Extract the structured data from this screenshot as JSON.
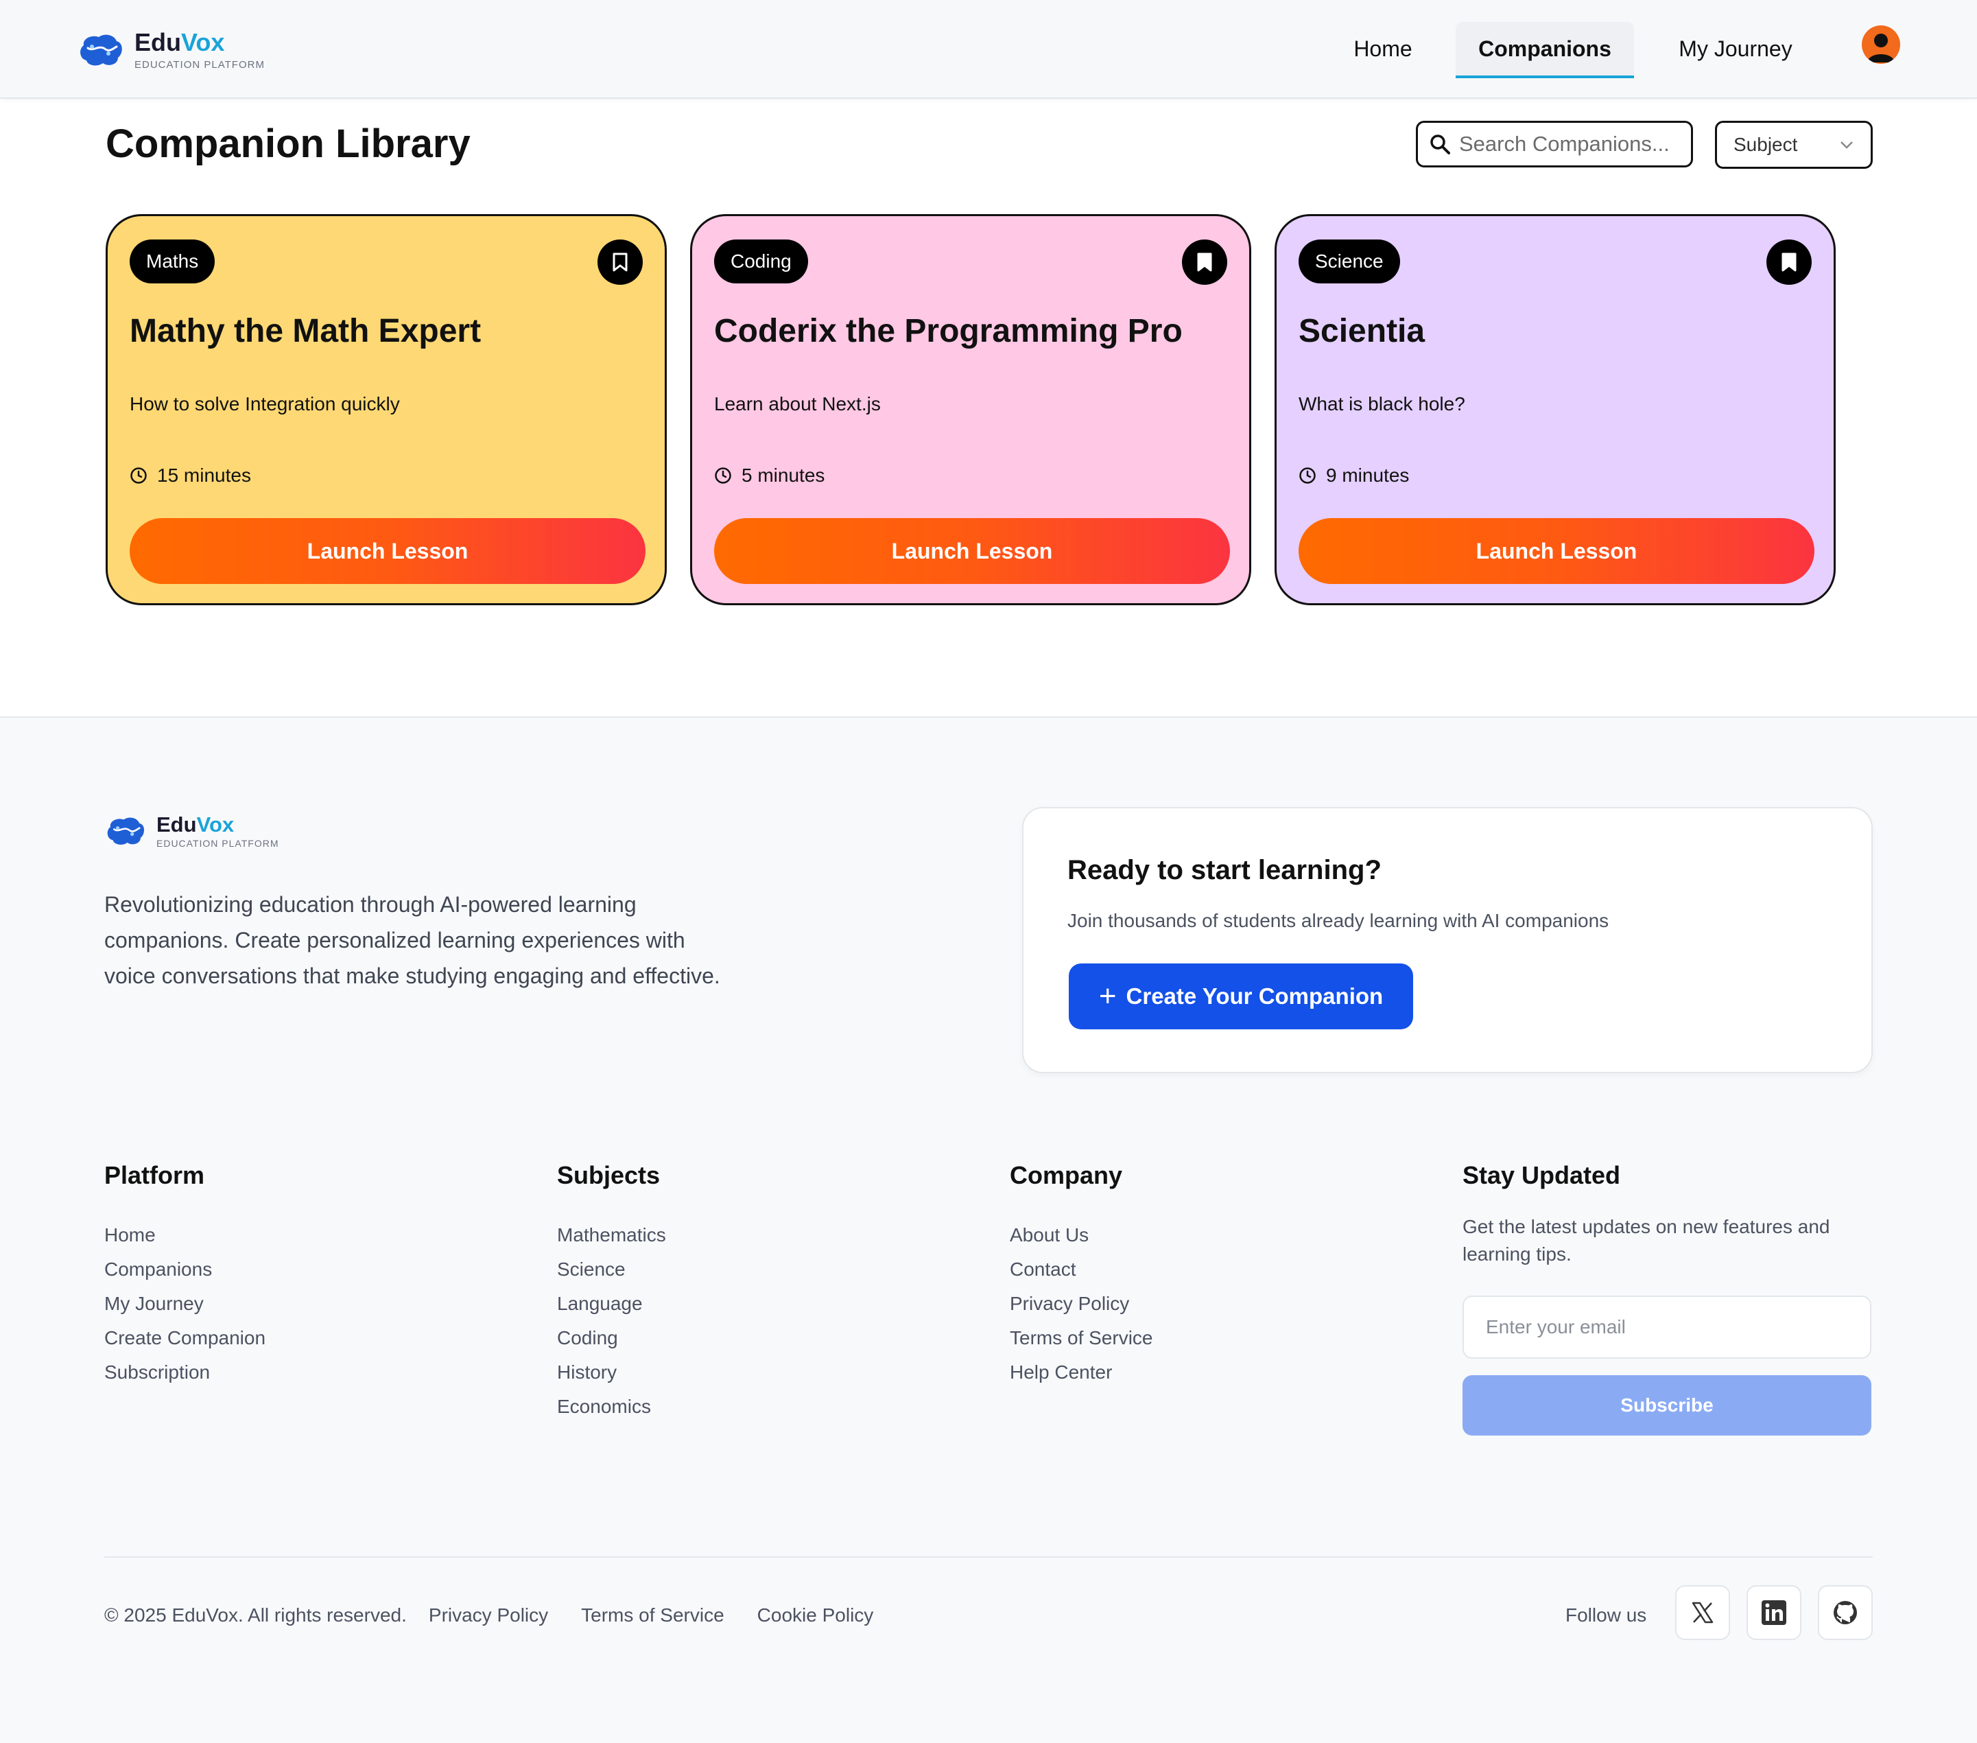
{
  "brand": {
    "name_part1": "Edu",
    "name_part2": "Vox",
    "tagline": "EDUCATION PLATFORM"
  },
  "nav": {
    "items": [
      {
        "label": "Home",
        "active": false
      },
      {
        "label": "Companions",
        "active": true
      },
      {
        "label": "My Journey",
        "active": false
      }
    ]
  },
  "library": {
    "title": "Companion Library",
    "search_placeholder": "Search Companions...",
    "subject_select": "Subject"
  },
  "cards": [
    {
      "subject": "Maths",
      "title": "Mathy the Math Expert",
      "topic": "How to solve Integration quickly",
      "duration": "15 minutes",
      "button": "Launch Lesson",
      "color": "#fed874"
    },
    {
      "subject": "Coding",
      "title": "Coderix the Programming Pro",
      "topic": "Learn about Next.js",
      "duration": "5 minutes",
      "button": "Launch Lesson",
      "color": "#ffc8e4"
    },
    {
      "subject": "Science",
      "title": "Scientia",
      "topic": "What is black hole?",
      "duration": "9 minutes",
      "button": "Launch Lesson",
      "color": "#e5d0ff"
    }
  ],
  "footer": {
    "description": "Revolutionizing education through AI-powered learning companions. Create personalized learning experiences with voice conversations that make studying engaging and effective.",
    "cta": {
      "title": "Ready to start learning?",
      "text": "Join thousands of students already learning with AI companions",
      "button": "Create Your Companion"
    },
    "columns": [
      {
        "title": "Platform",
        "links": [
          "Home",
          "Companions",
          "My Journey",
          "Create Companion",
          "Subscription"
        ]
      },
      {
        "title": "Subjects",
        "links": [
          "Mathematics",
          "Science",
          "Language",
          "Coding",
          "History",
          "Economics"
        ]
      },
      {
        "title": "Company",
        "links": [
          "About Us",
          "Contact",
          "Privacy Policy",
          "Terms of Service",
          "Help Center"
        ]
      }
    ],
    "stay_updated": {
      "title": "Stay Updated",
      "text": "Get the latest updates on new features and learning tips.",
      "email_placeholder": "Enter your email",
      "button": "Subscribe"
    },
    "copyright": "© 2025 EduVox. All rights reserved.",
    "bottom_links": [
      "Privacy Policy",
      "Terms of Service",
      "Cookie Policy"
    ],
    "follow_label": "Follow us",
    "social_icons": [
      "x-icon",
      "linkedin-icon",
      "github-icon"
    ]
  },
  "colors": {
    "accent_blue": "#1351e8",
    "launch_gradient_start": "#ff6a00",
    "launch_gradient_end": "#fb3440",
    "brand_vox": "#1aa3d9"
  }
}
